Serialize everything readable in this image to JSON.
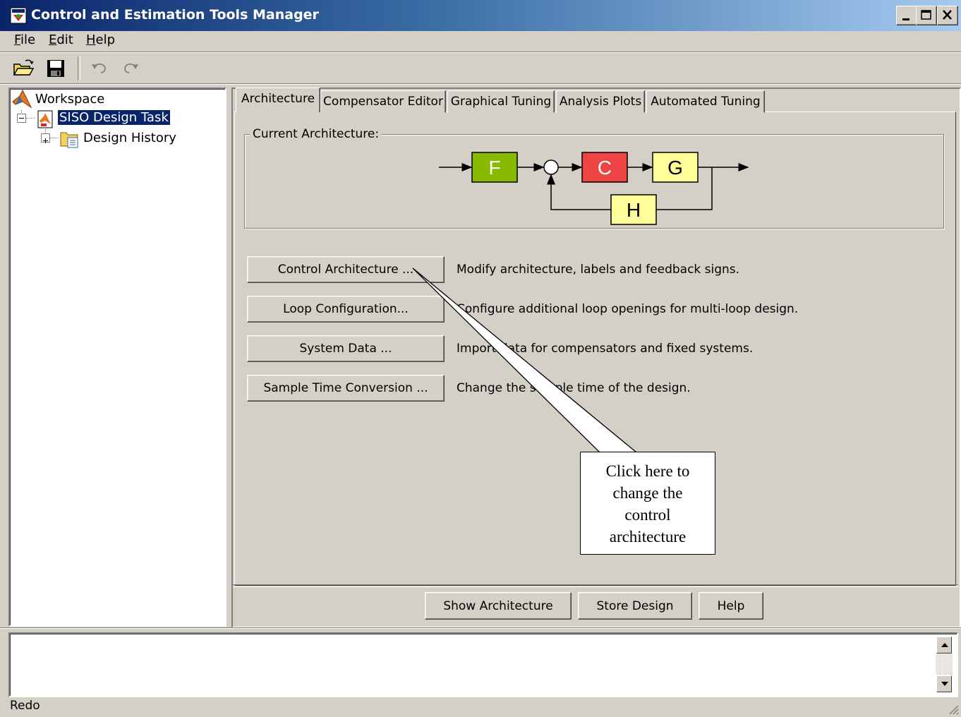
{
  "window": {
    "title": "Control and Estimation Tools Manager",
    "controls": {
      "minimize": "minimize-icon",
      "maximize": "maximize-icon",
      "close": "close-icon"
    }
  },
  "menu": {
    "file": {
      "accel": "F",
      "rest": "ile"
    },
    "edit": {
      "accel": "E",
      "rest": "dit"
    },
    "help": {
      "accel": "H",
      "rest": "elp"
    }
  },
  "toolbar": {
    "items": [
      "open-folder-icon",
      "save-disk-icon",
      "undo-icon",
      "redo-icon"
    ]
  },
  "tree": {
    "root": "Workspace",
    "task": "SISO Design Task",
    "child": "Design History"
  },
  "tabs": [
    {
      "label": "Architecture",
      "active": true
    },
    {
      "label": "Compensator Editor"
    },
    {
      "label": "Graphical Tuning"
    },
    {
      "label": "Analysis Plots"
    },
    {
      "label": "Automated Tuning"
    }
  ],
  "architecture": {
    "group_label": "Current Architecture:",
    "blocks": {
      "F": {
        "label": "F",
        "color": "#88bb00"
      },
      "C": {
        "label": "C",
        "color": "#ee4444"
      },
      "G": {
        "label": "G",
        "color": "#ffff99"
      },
      "H": {
        "label": "H",
        "color": "#ffff99"
      }
    }
  },
  "actions": [
    {
      "button": "Control Architecture ...",
      "description": "Modify architecture, labels and feedback signs."
    },
    {
      "button": "Loop Configuration...",
      "description": "Configure additional loop openings for multi-loop design."
    },
    {
      "button": "System Data ...",
      "description": "Import data for compensators and fixed systems."
    },
    {
      "button": "Sample Time Conversion ...",
      "description": "Change the sample time of the design."
    }
  ],
  "callout": {
    "lines": [
      "Click here to",
      "change the",
      "control",
      "architecture"
    ]
  },
  "footer_buttons": {
    "show_architecture": "Show Architecture",
    "store_design": "Store Design",
    "help": "Help"
  },
  "status": "Redo"
}
